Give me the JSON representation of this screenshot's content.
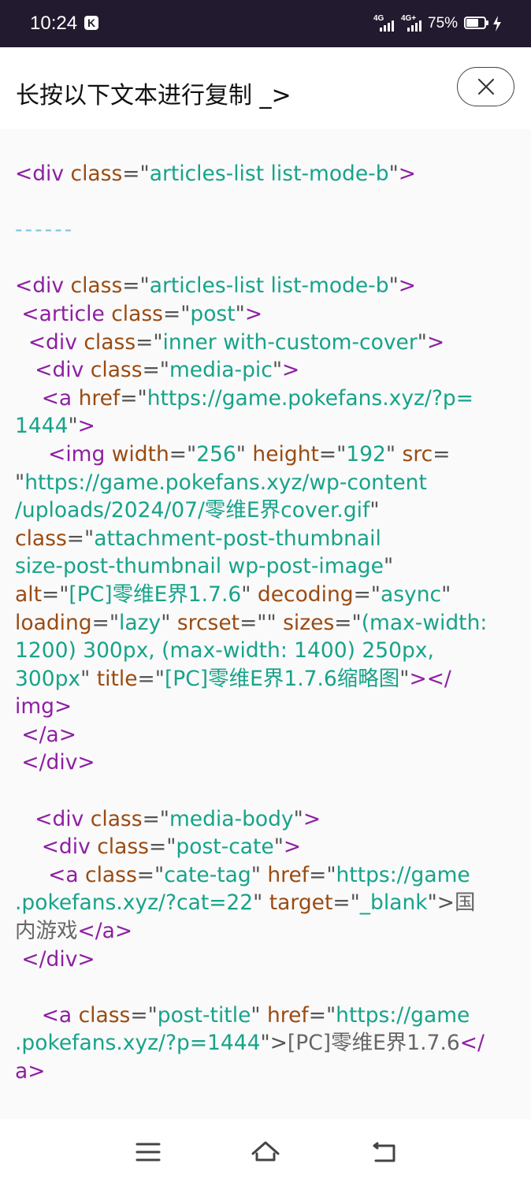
{
  "status_bar": {
    "time": "10:24",
    "notification_icon": "k-app-icon",
    "signal_1_label": "4G",
    "signal_2_label": "4G+",
    "battery_percent": "75%",
    "battery_level": 0.75,
    "charging": true
  },
  "header": {
    "title": "长按以下文本进行复制 _>",
    "close_icon": "close-icon"
  },
  "code_lines": [
    [
      {
        "c": "t",
        "s": "<div "
      },
      {
        "c": "a",
        "s": "class"
      },
      {
        "c": "p",
        "s": "=\""
      },
      {
        "c": "v",
        "s": "articles-list list-mode-b"
      },
      {
        "c": "p",
        "s": "\""
      },
      {
        "c": "t",
        "s": ">"
      }
    ],
    [],
    [
      {
        "c": "dashes",
        "s": "------"
      }
    ],
    [],
    [
      {
        "c": "t",
        "s": "<div "
      },
      {
        "c": "a",
        "s": "class"
      },
      {
        "c": "p",
        "s": "=\""
      },
      {
        "c": "v",
        "s": "articles-list list-mode-b"
      },
      {
        "c": "p",
        "s": "\""
      },
      {
        "c": "t",
        "s": ">"
      }
    ],
    [
      {
        "c": "t",
        "s": " <article "
      },
      {
        "c": "a",
        "s": "class"
      },
      {
        "c": "p",
        "s": "=\""
      },
      {
        "c": "v",
        "s": "post"
      },
      {
        "c": "p",
        "s": "\""
      },
      {
        "c": "t",
        "s": ">"
      }
    ],
    [
      {
        "c": "t",
        "s": "  <div "
      },
      {
        "c": "a",
        "s": "class"
      },
      {
        "c": "p",
        "s": "=\""
      },
      {
        "c": "v",
        "s": "inner with-custom-cover"
      },
      {
        "c": "p",
        "s": "\""
      },
      {
        "c": "t",
        "s": ">"
      }
    ],
    [
      {
        "c": "t",
        "s": "   <div "
      },
      {
        "c": "a",
        "s": "class"
      },
      {
        "c": "p",
        "s": "=\""
      },
      {
        "c": "v",
        "s": "media-pic"
      },
      {
        "c": "p",
        "s": "\""
      },
      {
        "c": "t",
        "s": ">"
      }
    ],
    [
      {
        "c": "t",
        "s": "    <a "
      },
      {
        "c": "a",
        "s": "href"
      },
      {
        "c": "p",
        "s": "=\""
      },
      {
        "c": "v",
        "s": "https://game.pokefans.xyz/?p="
      }
    ],
    [
      {
        "c": "v",
        "s": "1444"
      },
      {
        "c": "p",
        "s": "\""
      },
      {
        "c": "t",
        "s": ">"
      }
    ],
    [
      {
        "c": "t",
        "s": "     <img "
      },
      {
        "c": "a",
        "s": "width"
      },
      {
        "c": "p",
        "s": "=\""
      },
      {
        "c": "v",
        "s": "256"
      },
      {
        "c": "p",
        "s": "\" "
      },
      {
        "c": "a",
        "s": "height"
      },
      {
        "c": "p",
        "s": "=\""
      },
      {
        "c": "v",
        "s": "192"
      },
      {
        "c": "p",
        "s": "\" "
      },
      {
        "c": "a",
        "s": "src"
      },
      {
        "c": "p",
        "s": "="
      }
    ],
    [
      {
        "c": "p",
        "s": "\""
      },
      {
        "c": "v",
        "s": "https://game.pokefans.xyz/wp-content"
      }
    ],
    [
      {
        "c": "v",
        "s": "/uploads/2024/07/零维E界cover.gif"
      },
      {
        "c": "p",
        "s": "\""
      }
    ],
    [
      {
        "c": "a",
        "s": "class"
      },
      {
        "c": "p",
        "s": "=\""
      },
      {
        "c": "v",
        "s": "attachment-post-thumbnail"
      }
    ],
    [
      {
        "c": "v",
        "s": "size-post-thumbnail wp-post-image"
      },
      {
        "c": "p",
        "s": "\""
      }
    ],
    [
      {
        "c": "a",
        "s": "alt"
      },
      {
        "c": "p",
        "s": "=\""
      },
      {
        "c": "v",
        "s": "[PC]零维E界1.7.6"
      },
      {
        "c": "p",
        "s": "\" "
      },
      {
        "c": "a",
        "s": "decoding"
      },
      {
        "c": "p",
        "s": "=\""
      },
      {
        "c": "v",
        "s": "async"
      },
      {
        "c": "p",
        "s": "\""
      }
    ],
    [
      {
        "c": "a",
        "s": "loading"
      },
      {
        "c": "p",
        "s": "=\""
      },
      {
        "c": "v",
        "s": "lazy"
      },
      {
        "c": "p",
        "s": "\" "
      },
      {
        "c": "a",
        "s": "srcset"
      },
      {
        "c": "p",
        "s": "=\"\" "
      },
      {
        "c": "a",
        "s": "sizes"
      },
      {
        "c": "p",
        "s": "=\""
      },
      {
        "c": "v",
        "s": "(max-width:"
      }
    ],
    [
      {
        "c": "v",
        "s": "1200) 300px, (max-width: 1400) 250px,"
      }
    ],
    [
      {
        "c": "v",
        "s": "300px"
      },
      {
        "c": "p",
        "s": "\" "
      },
      {
        "c": "a",
        "s": "title"
      },
      {
        "c": "p",
        "s": "=\""
      },
      {
        "c": "v",
        "s": "[PC]零维E界1.7.6缩略图"
      },
      {
        "c": "p",
        "s": "\""
      },
      {
        "c": "t",
        "s": "></"
      }
    ],
    [
      {
        "c": "t",
        "s": "img>"
      }
    ],
    [
      {
        "c": "t",
        "s": " </a>"
      }
    ],
    [
      {
        "c": "t",
        "s": " </div>"
      }
    ],
    [],
    [
      {
        "c": "t",
        "s": "   <div "
      },
      {
        "c": "a",
        "s": "class"
      },
      {
        "c": "p",
        "s": "=\""
      },
      {
        "c": "v",
        "s": "media-body"
      },
      {
        "c": "p",
        "s": "\""
      },
      {
        "c": "t",
        "s": ">"
      }
    ],
    [
      {
        "c": "t",
        "s": "    <div "
      },
      {
        "c": "a",
        "s": "class"
      },
      {
        "c": "p",
        "s": "=\""
      },
      {
        "c": "v",
        "s": "post-cate"
      },
      {
        "c": "p",
        "s": "\""
      },
      {
        "c": "t",
        "s": ">"
      }
    ],
    [
      {
        "c": "t",
        "s": "     <a "
      },
      {
        "c": "a",
        "s": "class"
      },
      {
        "c": "p",
        "s": "=\""
      },
      {
        "c": "v",
        "s": "cate-tag"
      },
      {
        "c": "p",
        "s": "\" "
      },
      {
        "c": "a",
        "s": "href"
      },
      {
        "c": "p",
        "s": "=\""
      },
      {
        "c": "v",
        "s": "https://game"
      }
    ],
    [
      {
        "c": "v",
        "s": ".pokefans.xyz/?cat=22"
      },
      {
        "c": "p",
        "s": "\" "
      },
      {
        "c": "a",
        "s": "target"
      },
      {
        "c": "p",
        "s": "=\""
      },
      {
        "c": "v",
        "s": "_blank"
      },
      {
        "c": "p",
        "s": "\">"
      },
      {
        "c": "x",
        "s": "国"
      }
    ],
    [
      {
        "c": "x",
        "s": "内游戏"
      },
      {
        "c": "t",
        "s": "</a>"
      }
    ],
    [
      {
        "c": "t",
        "s": " </div>"
      }
    ],
    [],
    [
      {
        "c": "t",
        "s": "    <a "
      },
      {
        "c": "a",
        "s": "class"
      },
      {
        "c": "p",
        "s": "=\""
      },
      {
        "c": "v",
        "s": "post-title"
      },
      {
        "c": "p",
        "s": "\" "
      },
      {
        "c": "a",
        "s": "href"
      },
      {
        "c": "p",
        "s": "=\""
      },
      {
        "c": "v",
        "s": "https://game"
      }
    ],
    [
      {
        "c": "v",
        "s": ".pokefans.xyz/?p=1444"
      },
      {
        "c": "p",
        "s": "\">"
      },
      {
        "c": "x",
        "s": "[PC]零维E界1.7.6"
      },
      {
        "c": "t",
        "s": "</"
      }
    ],
    [
      {
        "c": "t",
        "s": "a>"
      }
    ]
  ],
  "nav_bar": {
    "menu_icon": "menu-icon",
    "home_icon": "home-icon",
    "back_icon": "back-icon"
  },
  "colors": {
    "status_bar_bg": "#221a2e",
    "tag": "#8e1fa3",
    "attribute": "#9a4b12",
    "value": "#17a38a",
    "separator": "#7ec4df"
  }
}
